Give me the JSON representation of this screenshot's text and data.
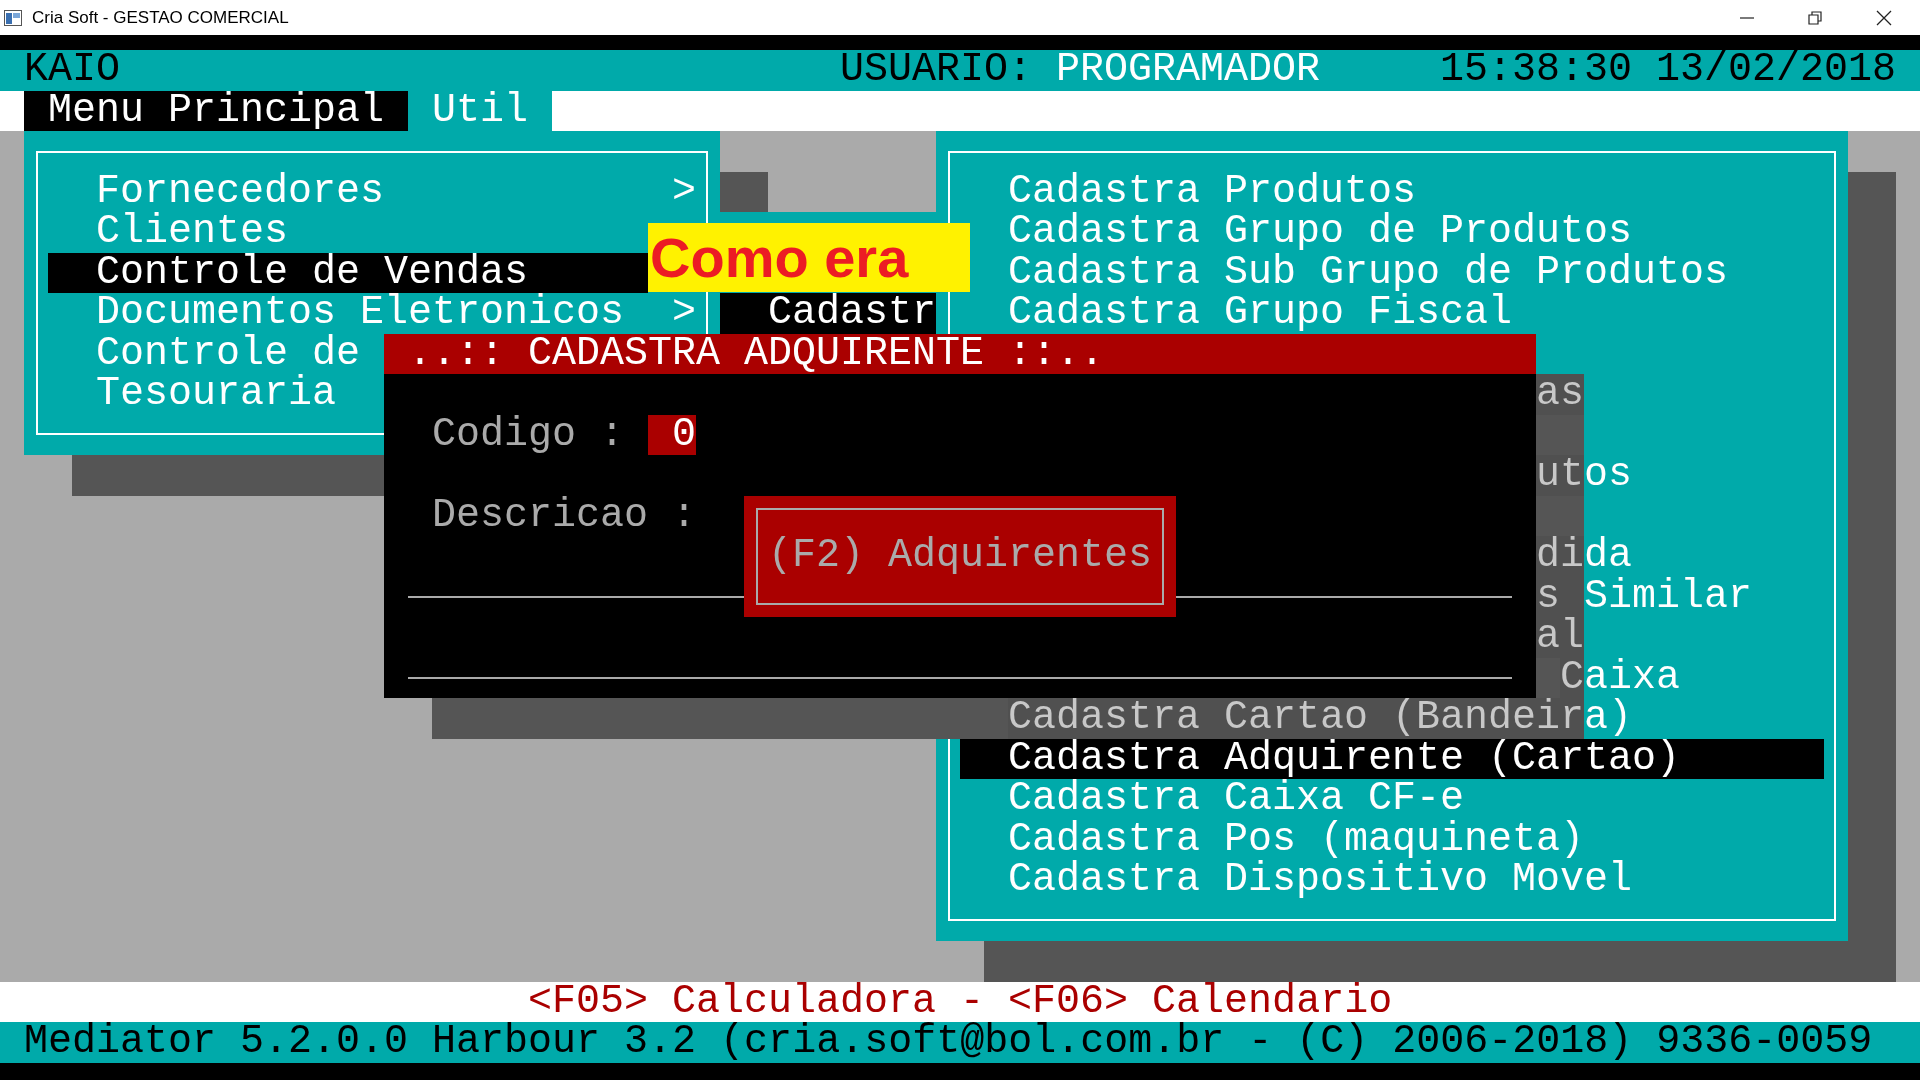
{
  "window": {
    "title": "Cria Soft - GESTAO COMERCIAL"
  },
  "header": {
    "company": "KAIO",
    "user_label": "USUARIO:",
    "user": "PROGRAMADOR",
    "datetime": "15:38:30 13/02/2018"
  },
  "menu_bar": [
    {
      "label": "Menu Principal",
      "selected": true
    },
    {
      "label": "Util",
      "selected": false
    }
  ],
  "main_menu": {
    "items": [
      {
        "label": "Fornecedores",
        "arrow": ">",
        "selected": false
      },
      {
        "label": "Clientes",
        "selected": false
      },
      {
        "label": "Controle de Vendas",
        "selected": true
      },
      {
        "label": "Documentos Eletronicos",
        "arrow": ">",
        "selected": false
      },
      {
        "label": "Controle de",
        "selected": false
      },
      {
        "label": "Tesouraria",
        "selected": false
      }
    ]
  },
  "submenu": {
    "items": [
      {
        "label": "Cadastr",
        "selected": true
      }
    ]
  },
  "cadastro_menu": {
    "items": [
      {
        "label": "Cadastra Produtos",
        "selected": false
      },
      {
        "label": "Cadastra Grupo de Produtos",
        "selected": false
      },
      {
        "label": "Cadastra Sub Grupo de Produtos",
        "selected": false
      },
      {
        "label": "Cadastra Grupo Fiscal",
        "selected": false
      },
      {
        "label": "as",
        "selected": false
      },
      {
        "label": "utos",
        "selected": false
      },
      {
        "label": "dida",
        "selected": false
      },
      {
        "label": "s Similar",
        "selected": false
      },
      {
        "label": "al",
        "selected": false
      },
      {
        "label": "Caixa",
        "selected": false
      },
      {
        "label": "Cadastra Cartao (Bandeira)",
        "selected": false
      },
      {
        "label": "Cadastra Adquirente (Cartao)",
        "selected": true
      },
      {
        "label": "Cadastra Caixa CF-e",
        "selected": false
      },
      {
        "label": "Cadastra Pos (maquineta)",
        "selected": false
      },
      {
        "label": "Cadastra Dispositivo Movel",
        "selected": false
      }
    ]
  },
  "annotation": {
    "text": "Como era"
  },
  "dialog": {
    "title": "..:: CADASTRA ADQUIRENTE ::..",
    "fields": [
      {
        "label": "Codigo :",
        "value": "0"
      },
      {
        "label": "Descricao :"
      }
    ],
    "popup": "(F2) Adquirentes"
  },
  "hotkeys": "<F05> Calculadora - <F06> Calendario",
  "status_bar": "Mediator 5.2.0.0 Harbour 3.2 (cria.soft@bol.com.br - (C) 2006-2018) 9336-0059"
}
